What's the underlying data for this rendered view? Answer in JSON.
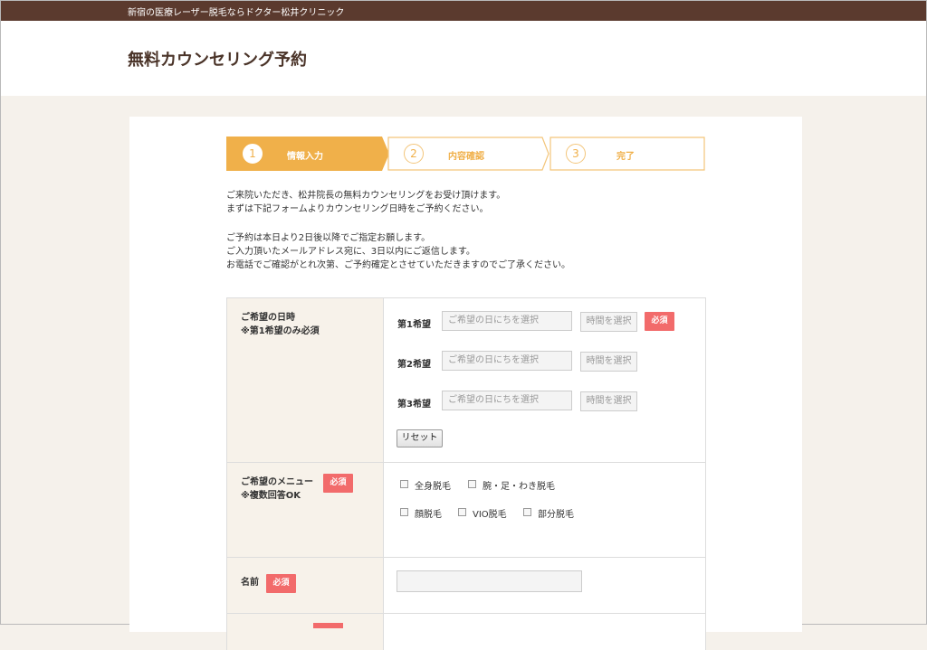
{
  "topbar": {
    "text": "新宿の医療レーザー脱毛ならドクター松井クリニック"
  },
  "header": {
    "title": "無料カウンセリング予約"
  },
  "steps": [
    {
      "num": "1",
      "label": "情報入力"
    },
    {
      "num": "2",
      "label": "内容確認"
    },
    {
      "num": "3",
      "label": "完了"
    }
  ],
  "intro": {
    "line1": "ご来院いただき、松井院長の無料カウンセリングをお受け頂けます。",
    "line2": "まずは下記フォームよりカウンセリング日時をご予約ください。",
    "line3": "ご予約は本日より2日後以降でご指定お願します。",
    "line4": "ご入力頂いたメールアドレス宛に、3日以内にご返信します。",
    "line5": "お電話でご確認がとれ次第、ご予約確定とさせていただきますのでご了承ください。"
  },
  "form": {
    "datetime": {
      "label1": "ご希望の日時",
      "label2": "※第1希望のみ必須",
      "prefs": [
        {
          "label": "第1希望",
          "date_placeholder": "ご希望の日にちを選択",
          "time_label": "時間を選択",
          "required": "必須"
        },
        {
          "label": "第2希望",
          "date_placeholder": "ご希望の日にちを選択",
          "time_label": "時間を選択"
        },
        {
          "label": "第3希望",
          "date_placeholder": "ご希望の日にちを選択",
          "time_label": "時間を選択"
        }
      ],
      "reset": "リセット"
    },
    "menu": {
      "label1": "ご希望のメニュー",
      "label2": "※複数回答OK",
      "required": "必須",
      "options": [
        "全身脱毛",
        "腕・足・わき脱毛",
        "顔脱毛",
        "VIO脱毛",
        "部分脱毛"
      ]
    },
    "name": {
      "label": "名前",
      "required": "必須",
      "value": ""
    }
  },
  "colors": {
    "accent": "#f0b04a",
    "brand": "#5b3a2e",
    "required": "#f26b6b"
  }
}
